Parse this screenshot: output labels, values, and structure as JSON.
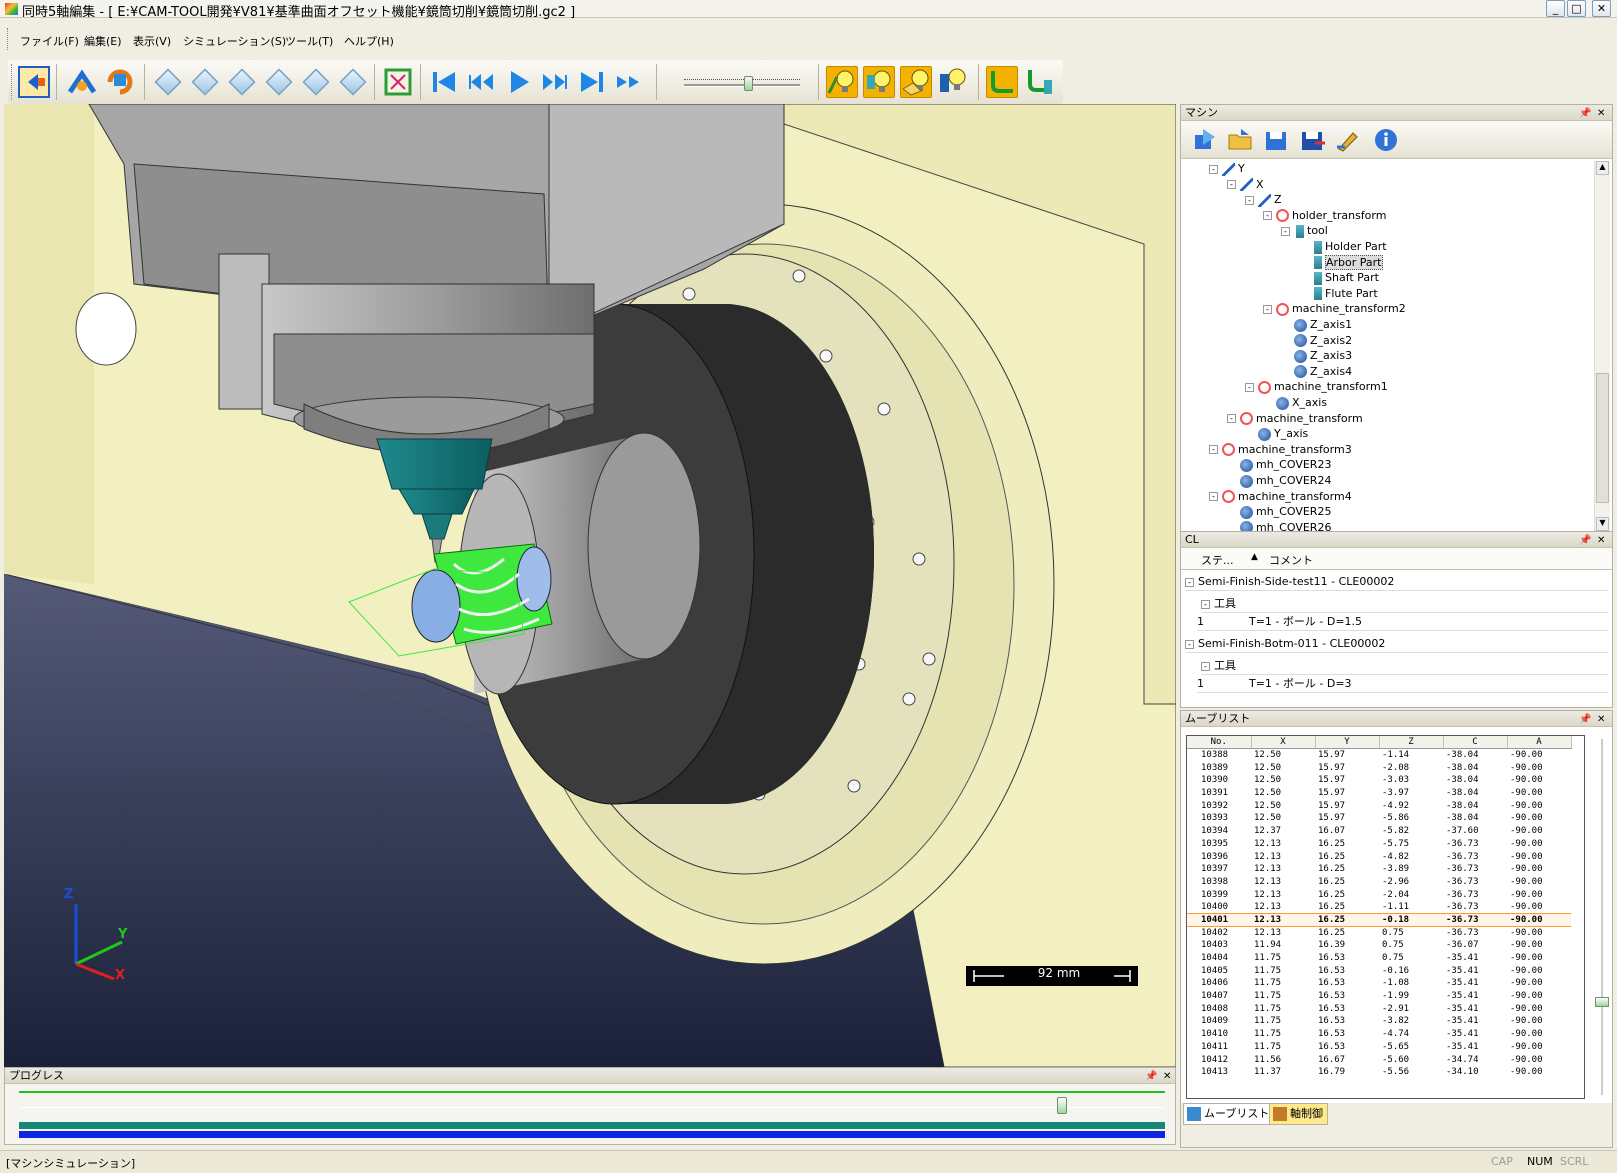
{
  "window": {
    "title": "同時5軸編集 - [ E:¥CAM-TOOL開発¥V81¥基準曲面オフセット機能¥鏡筒切削¥鏡筒切削.gc2 ]",
    "minimize": "_",
    "maximize": "□",
    "close": "✕"
  },
  "menu": {
    "items": [
      "ファイル(F)",
      "編集(E)",
      "表示(V)",
      "シミュレーション(S)",
      "ツール(T)",
      "ヘルプ(H)"
    ]
  },
  "toolbar": {
    "icons": [
      "exit-icon",
      "rotate-icon",
      "refresh-icon",
      "iso-view-1-icon",
      "iso-view-2-icon",
      "iso-view-3-icon",
      "iso-view-4-icon",
      "iso-view-5-icon",
      "iso-view-6-icon",
      "fit-view-icon",
      "go-start-icon",
      "step-back-icon",
      "play-icon",
      "step-forward-icon",
      "go-end-icon",
      "fast-forward-icon",
      "speed-slider",
      "light-1-icon",
      "light-2-icon",
      "light-3-icon",
      "light-4-icon",
      "path-1-icon",
      "path-2-icon"
    ],
    "speed_level": 0.55
  },
  "viewport": {
    "scale_label": "92 mm",
    "axes": {
      "z": "Z",
      "y": "Y",
      "x": "X"
    },
    "colors": {
      "machine": "#f2f0c0",
      "spindle": "#a8a8a8",
      "tool": "#1a8a8c",
      "workpiece": "#3eea3e",
      "background": "#1d2440"
    }
  },
  "progress": {
    "title": "プログレス",
    "position": 0.91,
    "bar1_color": "#14877a",
    "bar2_color": "#0b25e0"
  },
  "machine_panel": {
    "title": "マシン",
    "toolbar_icons": [
      "import-icon",
      "open-folder-icon",
      "save-icon",
      "save-as-icon",
      "edit-icon",
      "info-icon"
    ],
    "tree": [
      {
        "label": "Y",
        "depth": 0,
        "icon": "axis",
        "exp": "-"
      },
      {
        "label": "X",
        "depth": 1,
        "icon": "axis",
        "exp": "-"
      },
      {
        "label": "Z",
        "depth": 2,
        "icon": "axis",
        "exp": "-"
      },
      {
        "label": "holder_transform",
        "depth": 3,
        "icon": "trans",
        "exp": "-"
      },
      {
        "label": "tool",
        "depth": 4,
        "icon": "part",
        "exp": "-"
      },
      {
        "label": "Holder Part",
        "depth": 5,
        "icon": "part",
        "exp": ""
      },
      {
        "label": "Arbor Part",
        "depth": 5,
        "icon": "part",
        "exp": "",
        "selected": true
      },
      {
        "label": "Shaft Part",
        "depth": 5,
        "icon": "part",
        "exp": ""
      },
      {
        "label": "Flute Part",
        "depth": 5,
        "icon": "part",
        "exp": ""
      },
      {
        "label": "machine_transform2",
        "depth": 3,
        "icon": "trans",
        "exp": "-"
      },
      {
        "label": "Z_axis1",
        "depth": 4,
        "icon": "obj",
        "exp": ""
      },
      {
        "label": "Z_axis2",
        "depth": 4,
        "icon": "obj",
        "exp": ""
      },
      {
        "label": "Z_axis3",
        "depth": 4,
        "icon": "obj",
        "exp": ""
      },
      {
        "label": "Z_axis4",
        "depth": 4,
        "icon": "obj",
        "exp": ""
      },
      {
        "label": "machine_transform1",
        "depth": 2,
        "icon": "trans",
        "exp": "-"
      },
      {
        "label": "X_axis",
        "depth": 3,
        "icon": "obj",
        "exp": ""
      },
      {
        "label": "machine_transform",
        "depth": 1,
        "icon": "trans",
        "exp": "-"
      },
      {
        "label": "Y_axis",
        "depth": 2,
        "icon": "obj",
        "exp": ""
      },
      {
        "label": "machine_transform3",
        "depth": 0,
        "icon": "trans",
        "exp": "-"
      },
      {
        "label": "mh_COVER23",
        "depth": 1,
        "icon": "obj",
        "exp": ""
      },
      {
        "label": "mh_COVER24",
        "depth": 1,
        "icon": "obj",
        "exp": ""
      },
      {
        "label": "machine_transform4",
        "depth": 0,
        "icon": "trans",
        "exp": "-"
      },
      {
        "label": "mh_COVER25",
        "depth": 1,
        "icon": "obj",
        "exp": ""
      },
      {
        "label": "mh_COVER26",
        "depth": 1,
        "icon": "obj",
        "exp": ""
      }
    ]
  },
  "cl_panel": {
    "title": "CL",
    "col_step": "ステ...",
    "col_comment": "コメント",
    "groups": [
      {
        "name": "Semi-Finish-Side-test11 - CLE00002",
        "sub": "工具",
        "row_no": "1",
        "row_text": "T=1 - ボール - D=1.5"
      },
      {
        "name": "Semi-Finish-Botm-011 - CLE00002",
        "sub": "工具",
        "row_no": "1",
        "row_text": "T=1 - ボール - D=3"
      }
    ]
  },
  "move_list": {
    "title": "ムーブリスト",
    "headers": [
      "No.",
      "X",
      "Y",
      "Z",
      "C",
      "A"
    ],
    "rows": [
      [
        "10388",
        "12.50",
        "15.97",
        "-1.14",
        "-38.04",
        "-90.00"
      ],
      [
        "10389",
        "12.50",
        "15.97",
        "-2.08",
        "-38.04",
        "-90.00"
      ],
      [
        "10390",
        "12.50",
        "15.97",
        "-3.03",
        "-38.04",
        "-90.00"
      ],
      [
        "10391",
        "12.50",
        "15.97",
        "-3.97",
        "-38.04",
        "-90.00"
      ],
      [
        "10392",
        "12.50",
        "15.97",
        "-4.92",
        "-38.04",
        "-90.00"
      ],
      [
        "10393",
        "12.50",
        "15.97",
        "-5.86",
        "-38.04",
        "-90.00"
      ],
      [
        "10394",
        "12.37",
        "16.07",
        "-5.82",
        "-37.60",
        "-90.00"
      ],
      [
        "10395",
        "12.13",
        "16.25",
        "-5.75",
        "-36.73",
        "-90.00"
      ],
      [
        "10396",
        "12.13",
        "16.25",
        "-4.82",
        "-36.73",
        "-90.00"
      ],
      [
        "10397",
        "12.13",
        "16.25",
        "-3.89",
        "-36.73",
        "-90.00"
      ],
      [
        "10398",
        "12.13",
        "16.25",
        "-2.96",
        "-36.73",
        "-90.00"
      ],
      [
        "10399",
        "12.13",
        "16.25",
        "-2.04",
        "-36.73",
        "-90.00"
      ],
      [
        "10400",
        "12.13",
        "16.25",
        "-1.11",
        "-36.73",
        "-90.00"
      ],
      [
        "10401",
        "12.13",
        "16.25",
        "-0.18",
        "-36.73",
        "-90.00"
      ],
      [
        "10402",
        "12.13",
        "16.25",
        "0.75",
        "-36.73",
        "-90.00"
      ],
      [
        "10403",
        "11.94",
        "16.39",
        "0.75",
        "-36.07",
        "-90.00"
      ],
      [
        "10404",
        "11.75",
        "16.53",
        "0.75",
        "-35.41",
        "-90.00"
      ],
      [
        "10405",
        "11.75",
        "16.53",
        "-0.16",
        "-35.41",
        "-90.00"
      ],
      [
        "10406",
        "11.75",
        "16.53",
        "-1.08",
        "-35.41",
        "-90.00"
      ],
      [
        "10407",
        "11.75",
        "16.53",
        "-1.99",
        "-35.41",
        "-90.00"
      ],
      [
        "10408",
        "11.75",
        "16.53",
        "-2.91",
        "-35.41",
        "-90.00"
      ],
      [
        "10409",
        "11.75",
        "16.53",
        "-3.82",
        "-35.41",
        "-90.00"
      ],
      [
        "10410",
        "11.75",
        "16.53",
        "-4.74",
        "-35.41",
        "-90.00"
      ],
      [
        "10411",
        "11.75",
        "16.53",
        "-5.65",
        "-35.41",
        "-90.00"
      ],
      [
        "10412",
        "11.56",
        "16.67",
        "-5.60",
        "-34.74",
        "-90.00"
      ],
      [
        "10413",
        "11.37",
        "16.79",
        "-5.56",
        "-34.10",
        "-90.00"
      ]
    ],
    "current_row": 13,
    "tabs": [
      "ムーブリスト",
      "軸制御"
    ]
  },
  "status": {
    "left": "[マシンシミュレーション]",
    "cap": "CAP",
    "num": "NUM",
    "scrl": "SCRL"
  }
}
